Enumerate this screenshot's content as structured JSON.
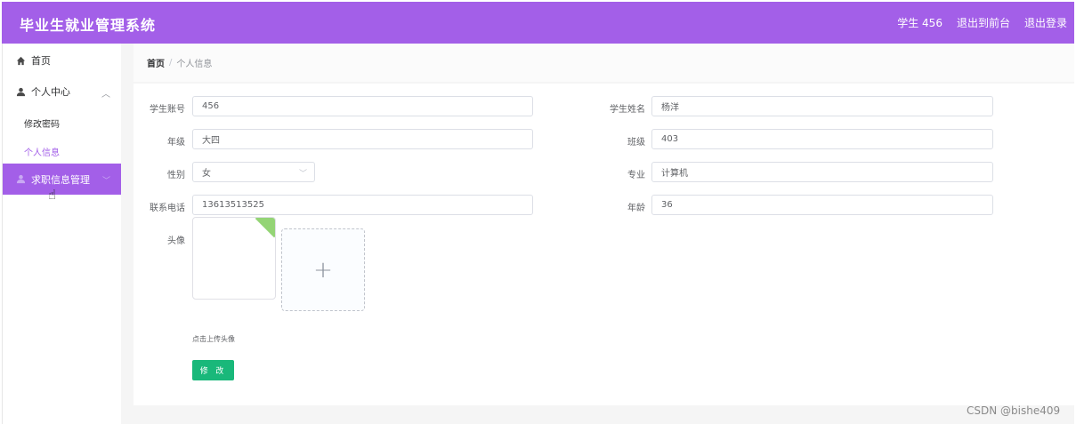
{
  "header": {
    "app_title": "毕业生就业管理系统",
    "user": "学生 456",
    "to_frontend": "退出到前台",
    "logout": "退出登录"
  },
  "sidebar": {
    "home": "首页",
    "personal_center": "个人中心",
    "change_password": "修改密码",
    "personal_info": "个人信息",
    "job_info_manage": "求职信息管理"
  },
  "breadcrumb": {
    "home": "首页",
    "separator": "/",
    "current": "个人信息"
  },
  "form": {
    "student_account": {
      "label": "学生账号",
      "value": "456"
    },
    "student_name": {
      "label": "学生姓名",
      "value": "杨洋"
    },
    "grade": {
      "label": "年级",
      "value": "大四"
    },
    "class": {
      "label": "班级",
      "value": "403"
    },
    "gender": {
      "label": "性别",
      "value": "女"
    },
    "major": {
      "label": "专业",
      "value": "计算机"
    },
    "phone": {
      "label": "联系电话",
      "value": "13613513525"
    },
    "age": {
      "label": "年龄",
      "value": "36"
    },
    "avatar": {
      "label": "头像",
      "tip": "点击上传头像"
    },
    "submit": "修 改"
  },
  "watermark": "CSDN @bishe409",
  "colors": {
    "accent": "#a35fe8",
    "button": "#19b87a"
  },
  "icons": {
    "home": "home-icon",
    "user": "user-icon",
    "upload": "plus-icon"
  }
}
